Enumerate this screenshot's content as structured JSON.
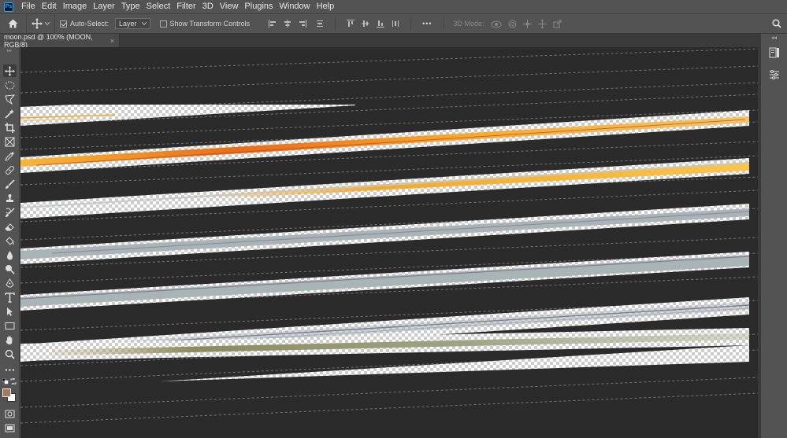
{
  "app": {
    "logo_text": "Ps"
  },
  "menu": [
    "File",
    "Edit",
    "Image",
    "Layer",
    "Type",
    "Select",
    "Filter",
    "3D",
    "View",
    "Plugins",
    "Window",
    "Help"
  ],
  "options": {
    "auto_select_label": "Auto-Select:",
    "auto_select_checked": true,
    "auto_select_target": "Layer",
    "show_transform_label": "Show Transform Controls",
    "show_transform_checked": false,
    "mode_3d_label": "3D Mode:",
    "more_label": "•••"
  },
  "document": {
    "tab_title": "moon.psd @ 100% (MOON, RGB/8)",
    "close_glyph": "×"
  },
  "colors": {
    "foreground": "#a57a5b",
    "background": "#ffffff",
    "canvas_bg": "#2b2b2b",
    "orange": "#f6a623",
    "gray_blue": "#a9b5b4",
    "olive": "#8c8f6a"
  },
  "tools": [
    "move-tool",
    "marquee-tool",
    "lasso-tool",
    "magic-wand-tool",
    "crop-tool",
    "frame-tool",
    "eyedropper-tool",
    "healing-brush-tool",
    "brush-tool",
    "clone-stamp-tool",
    "history-brush-tool",
    "eraser-tool",
    "paint-bucket-tool",
    "blur-tool",
    "dodge-tool",
    "pen-tool",
    "type-tool",
    "path-selection-tool",
    "rectangle-tool",
    "hand-tool",
    "zoom-tool",
    "edit-toolbar"
  ],
  "right_panel": [
    "libraries-icon",
    "adjustments-icon"
  ]
}
